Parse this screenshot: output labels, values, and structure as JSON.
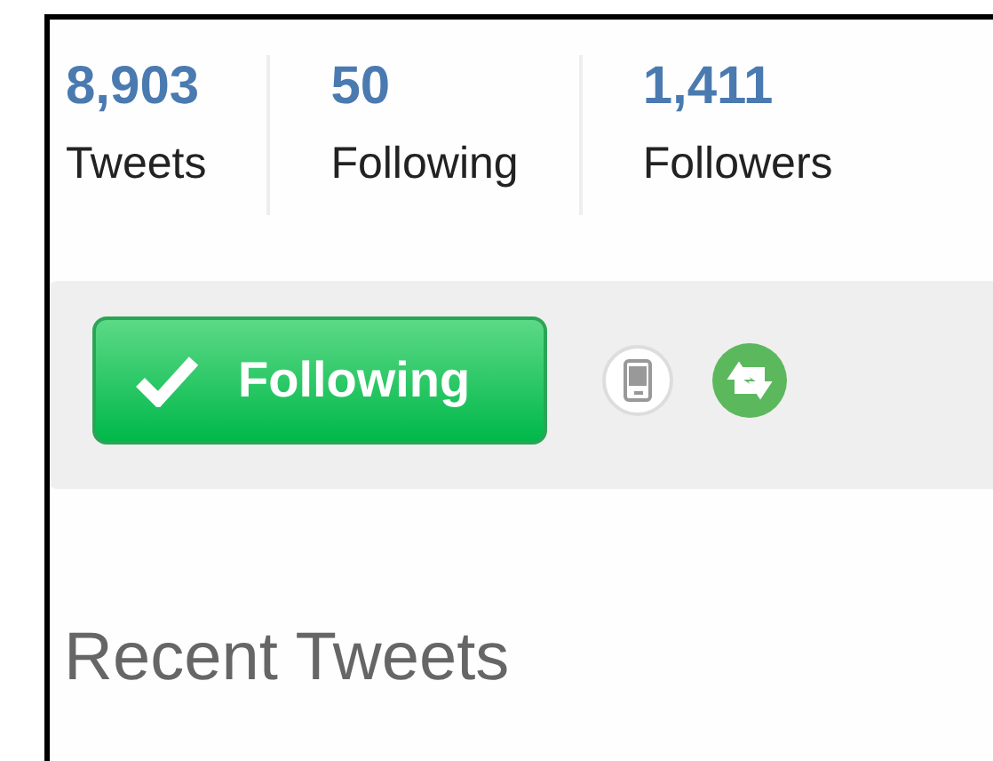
{
  "stats": [
    {
      "value": "8,903",
      "label": "Tweets"
    },
    {
      "value": "50",
      "label": "Following"
    },
    {
      "value": "1,411",
      "label": "Followers"
    }
  ],
  "follow_button": {
    "label": "Following",
    "following": true
  },
  "section_title": "Recent Tweets"
}
